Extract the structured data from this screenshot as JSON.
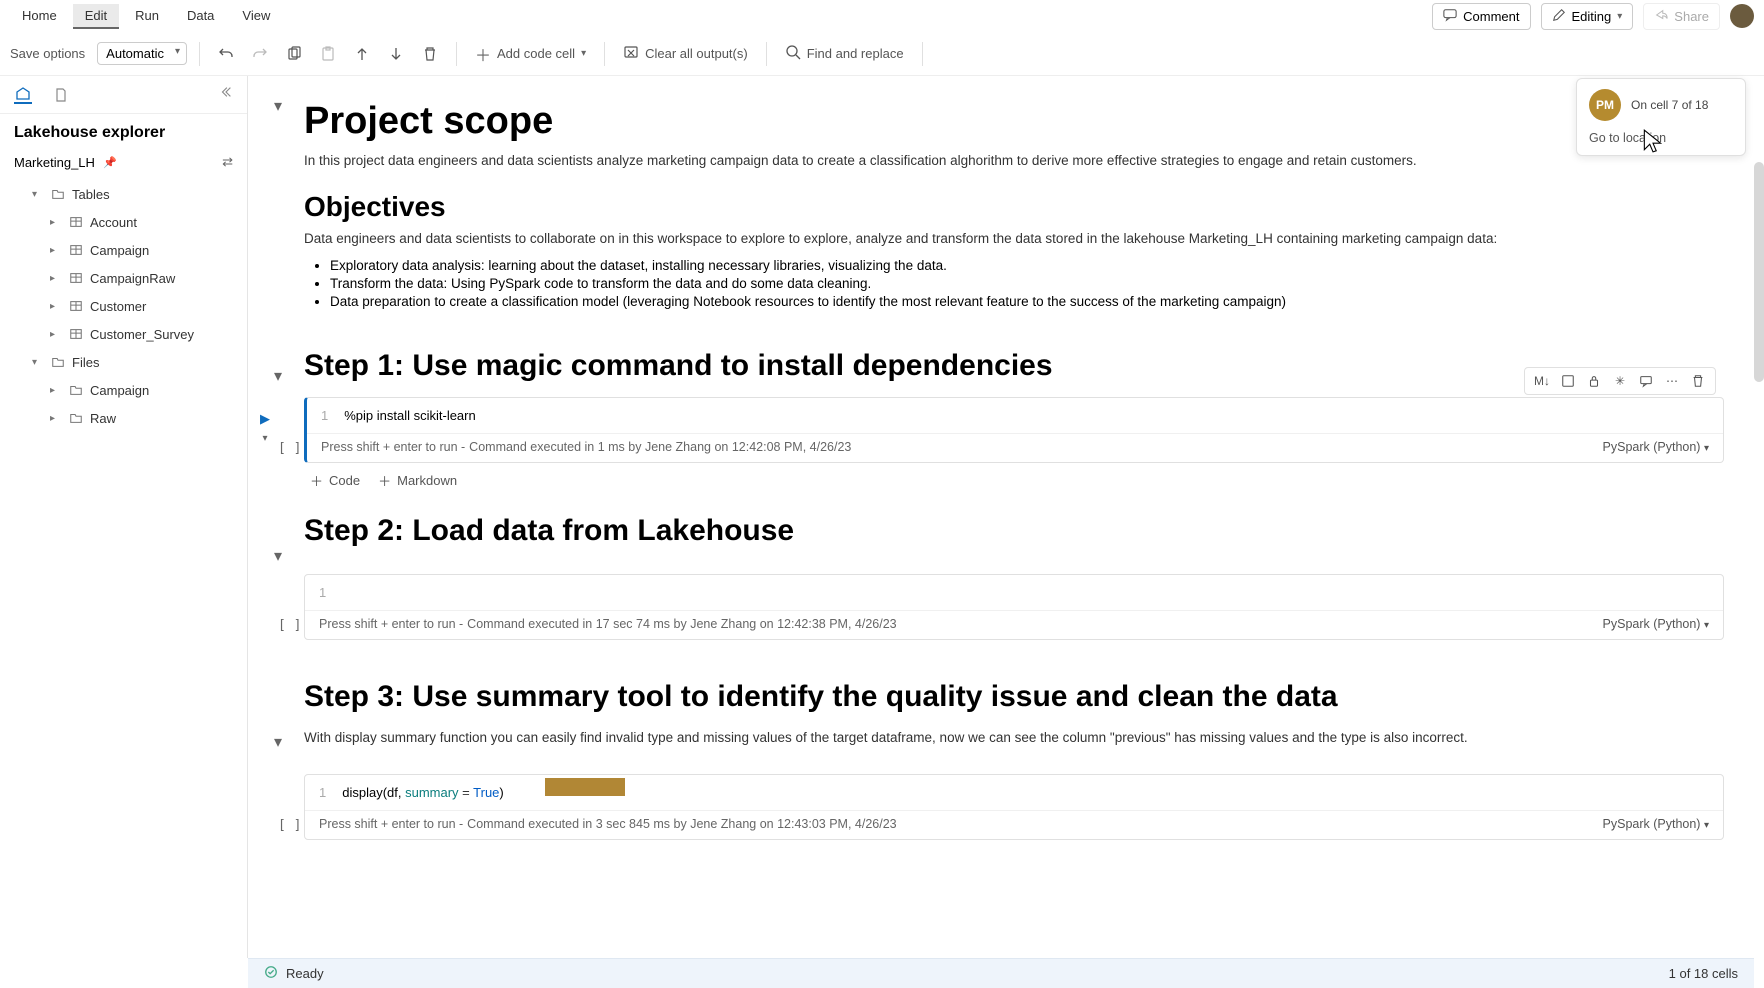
{
  "menu": {
    "home": "Home",
    "edit": "Edit",
    "run": "Run",
    "data": "Data",
    "view": "View"
  },
  "topbar": {
    "comment": "Comment",
    "editing": "Editing",
    "share": "Share"
  },
  "toolbar": {
    "save_label": "Save options",
    "save_mode": "Automatic",
    "add_code": "Add code cell",
    "clear_output": "Clear all output(s)",
    "find_replace": "Find and replace"
  },
  "sidebar": {
    "title": "Lakehouse explorer",
    "lakehouse": "Marketing_LH",
    "tables_label": "Tables",
    "files_label": "Files",
    "tables": [
      "Account",
      "Campaign",
      "CampaignRaw",
      "Customer",
      "Customer_Survey"
    ],
    "files": [
      "Campaign",
      "Raw"
    ]
  },
  "presence": {
    "initials": "PM",
    "status": "On cell 7 of 18",
    "link": "Go to location"
  },
  "doc": {
    "h_scope": "Project scope",
    "scope_text": "In this project data engineers and data scientists analyze marketing campaign data to create a classification alghorithm to derive more effective strategies to engage and retain customers.",
    "h_obj": "Objectives",
    "obj_intro": "Data engineers and data scientists to collaborate on in this workspace to explore to explore, analyze and transform the data stored in the lakehouse Marketing_LH containing marketing campaign data:",
    "obj_items": [
      "Exploratory data analysis: learning about the dataset, installing necessary libraries, visualizing the data.",
      "Transform the data: Using PySpark code to transform the data and do some data cleaning.",
      "Data preparation to create a classification model (leveraging Notebook resources to identify the most relevant feature to the success of the marketing campaign)"
    ],
    "step1_h": "Step 1: Use magic command to install dependencies",
    "step2_h": "Step 2: Load data from Lakehouse",
    "step3_h": "Step 3: Use summary tool to identify the quality issue and clean the data",
    "step3_text": "With display summary function you can easily find invalid type and missing values of the target dataframe, now we can see the column \"previous\" has missing values and the type is also incorrect."
  },
  "cells": {
    "c1_code": "%pip install scikit-learn",
    "c1_status_l": "Press shift + enter to run - ",
    "c1_status_r": "Command executed in 1 ms by Jene Zhang on 12:42:08 PM, 4/26/23",
    "c2_status_l": "Press shift + enter to run - ",
    "c2_status_r": "Command executed in 17 sec 74 ms by Jene Zhang on 12:42:38 PM, 4/26/23",
    "c3_code_pre": "display(df, ",
    "c3_code_arg": "summary",
    "c3_code_eq": " = ",
    "c3_code_true": "True",
    "c3_code_post": ")",
    "c3_status_l": "Press shift + enter to run - ",
    "c3_status_r": "Command executed in 3 sec 845 ms by Jene Zhang on 12:43:03 PM, 4/26/23",
    "kernel": "PySpark (Python)",
    "line_1": "1",
    "insert_code": "Code",
    "insert_md": "Markdown",
    "bracket": "[  ]",
    "ml_badge": "M↓"
  },
  "statusbar": {
    "ready": "Ready",
    "cells": "1 of 18 cells"
  }
}
